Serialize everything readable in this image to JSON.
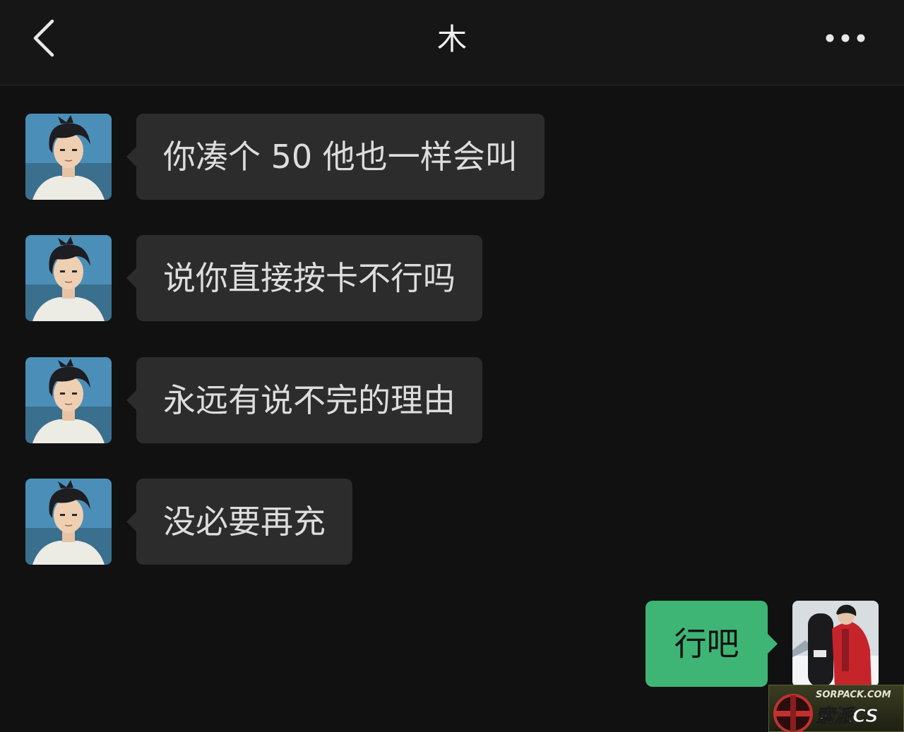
{
  "header": {
    "title": "木"
  },
  "messages": [
    {
      "side": "in",
      "text": "你凑个 50 他也一样会叫"
    },
    {
      "side": "in",
      "text": "说你直接按卡不行吗"
    },
    {
      "side": "in",
      "text": "永远有说不完的理由"
    },
    {
      "side": "in",
      "text": "没必要再充"
    },
    {
      "side": "out",
      "text": "行吧"
    }
  ],
  "watermark": {
    "line1": "SORPACK.COM",
    "line2": "索派CS"
  },
  "colors": {
    "background": "#111111",
    "incoming_bubble": "#2c2c2c",
    "outgoing_bubble": "#3eb575",
    "text": "#dddddd"
  },
  "icons": {
    "back": "chevron-left-icon",
    "more": "more-dots-icon"
  }
}
